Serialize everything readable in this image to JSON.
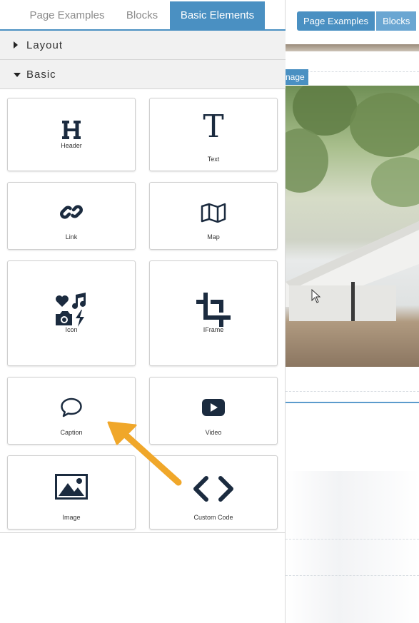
{
  "tabs": [
    {
      "label": "Page Examples",
      "active": false
    },
    {
      "label": "Blocks",
      "active": false
    },
    {
      "label": "Basic Elements",
      "active": true
    }
  ],
  "sections": {
    "layout": {
      "label": "Layout",
      "expanded": false
    },
    "basic": {
      "label": "Basic",
      "expanded": true
    }
  },
  "elements": [
    {
      "label": "Header",
      "icon": "header-h-icon"
    },
    {
      "label": "Text",
      "icon": "text-t-icon"
    },
    {
      "label": "Link",
      "icon": "link-icon"
    },
    {
      "label": "Map",
      "icon": "map-icon"
    },
    {
      "label": "Icon",
      "icon": "icon-collage-icon"
    },
    {
      "label": "IFrame",
      "icon": "crop-icon"
    },
    {
      "label": "Caption",
      "icon": "speech-bubble-icon"
    },
    {
      "label": "Video",
      "icon": "youtube-play-icon"
    },
    {
      "label": "Image",
      "icon": "image-icon"
    },
    {
      "label": "Custom Code",
      "icon": "code-brackets-icon"
    }
  ],
  "preview": {
    "tabs": [
      {
        "label": "Page Examples"
      },
      {
        "label": "Blocks"
      }
    ],
    "image_label": "nage"
  },
  "colors": {
    "accent": "#4a90c2",
    "icon": "#1b2b3f",
    "arrow": "#f0a72a"
  }
}
